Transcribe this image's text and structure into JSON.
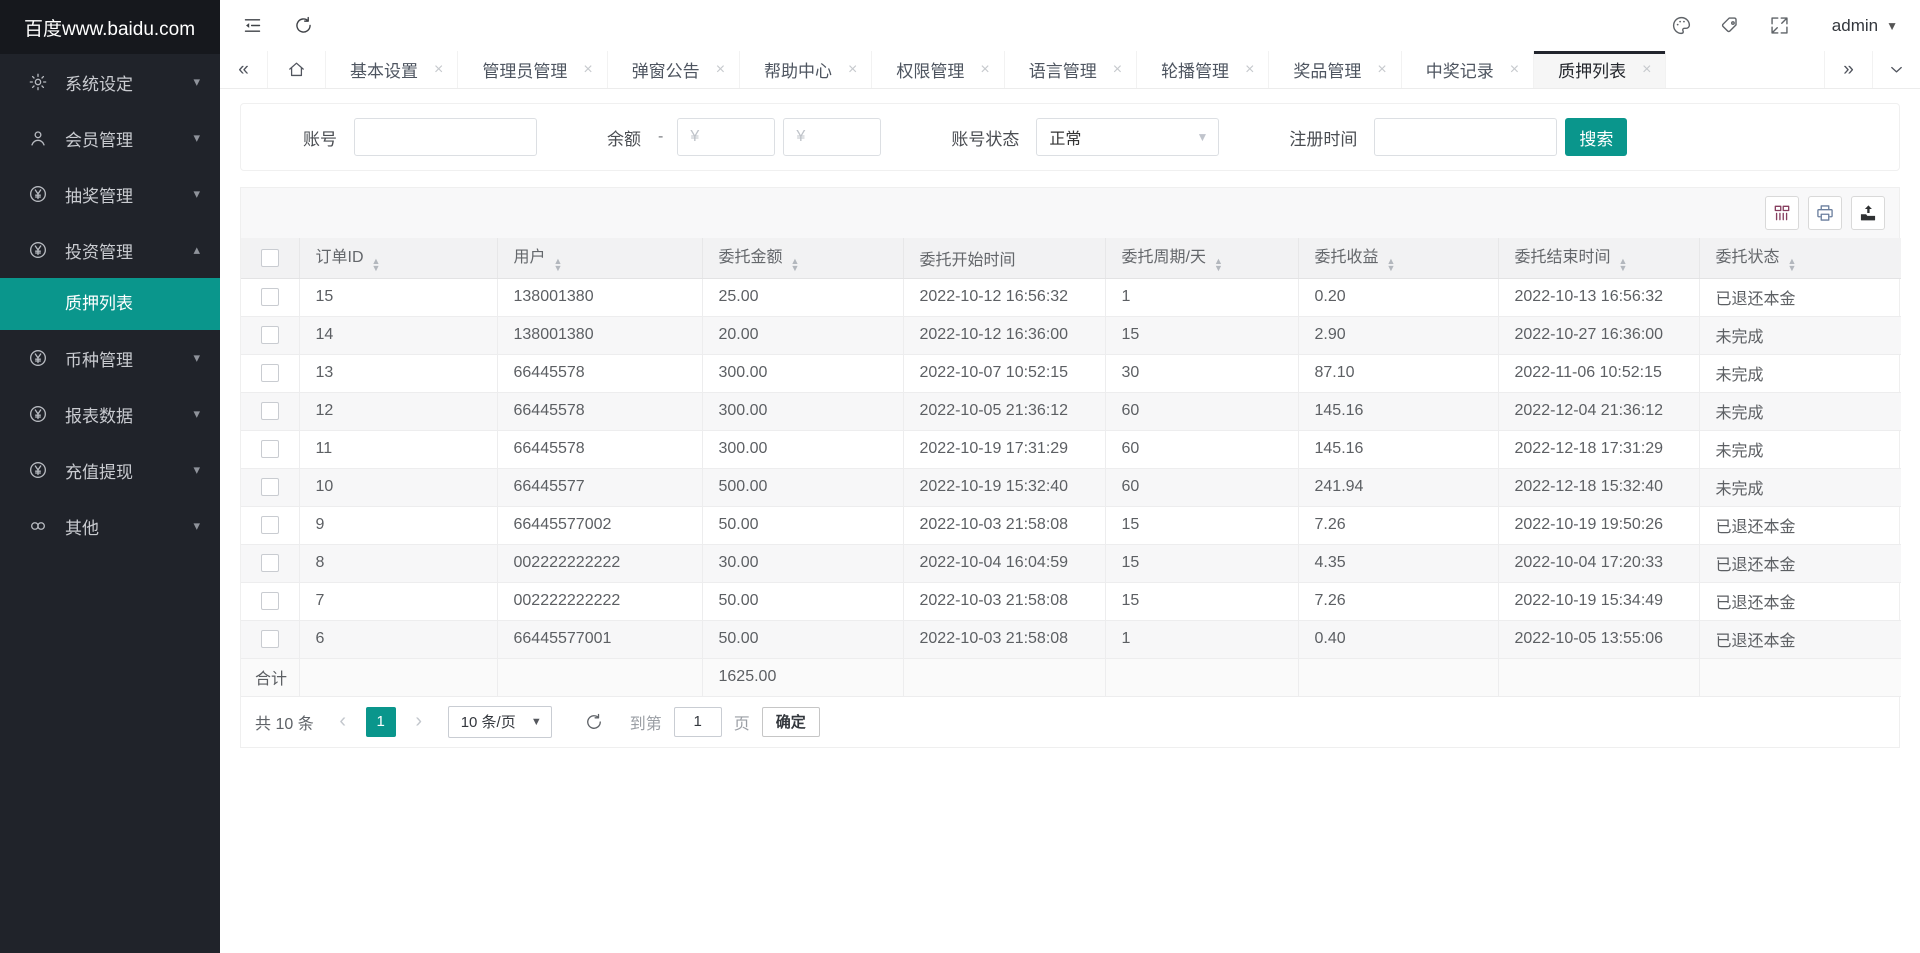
{
  "app": {
    "logo": "百度www.baidu.com",
    "admin_label": "admin"
  },
  "colors": {
    "accent_teal": "#0a968c",
    "sidebar_bg": "#20232a",
    "logo_bg": "#16181d",
    "active_tab_border": "#22252d"
  },
  "sidebar": {
    "items": [
      {
        "icon": "gear-icon",
        "label": "系统设定",
        "expanded": false
      },
      {
        "icon": "user-icon",
        "label": "会员管理",
        "expanded": false
      },
      {
        "icon": "yen-circle-icon",
        "label": "抽奖管理",
        "expanded": false
      },
      {
        "icon": "yen-circle-icon",
        "label": "投资管理",
        "expanded": true,
        "submenu": [
          {
            "label": "质押列表",
            "active": true
          }
        ]
      },
      {
        "icon": "yen-circle-icon",
        "label": "币种管理",
        "expanded": false
      },
      {
        "icon": "yen-circle-icon",
        "label": "报表数据",
        "expanded": false
      },
      {
        "icon": "yen-circle-icon",
        "label": "充值提现",
        "expanded": false
      },
      {
        "icon": "link-icon",
        "label": "其他",
        "expanded": false
      }
    ]
  },
  "tabbar": {
    "tabs": [
      {
        "label": "基本设置",
        "active": false
      },
      {
        "label": "管理员管理",
        "active": false
      },
      {
        "label": "弹窗公告",
        "active": false
      },
      {
        "label": "帮助中心",
        "active": false
      },
      {
        "label": "权限管理",
        "active": false
      },
      {
        "label": "语言管理",
        "active": false
      },
      {
        "label": "轮播管理",
        "active": false
      },
      {
        "label": "奖品管理",
        "active": false
      },
      {
        "label": "中奖记录",
        "active": false
      },
      {
        "label": "质押列表",
        "active": true
      }
    ]
  },
  "filter": {
    "account_label": "账号",
    "balance_label": "余额",
    "dash": "-",
    "amount_placeholder": "¥",
    "status_label": "账号状态",
    "status_value": "正常",
    "regtime_label": "注册时间",
    "search_label": "搜索"
  },
  "toolbar": {
    "buttons": [
      "columns-icon",
      "print-icon",
      "export-icon"
    ]
  },
  "table": {
    "columns": [
      {
        "label": "订单ID",
        "sortable": true
      },
      {
        "label": "用户",
        "sortable": true
      },
      {
        "label": "委托金额",
        "sortable": true
      },
      {
        "label": "委托开始时间",
        "sortable": false
      },
      {
        "label": "委托周期/天",
        "sortable": true
      },
      {
        "label": "委托收益",
        "sortable": true
      },
      {
        "label": "委托结束时间",
        "sortable": true
      },
      {
        "label": "委托状态",
        "sortable": true
      }
    ],
    "rows": [
      [
        "15",
        "138001380",
        "25.00",
        "2022-10-12 16:56:32",
        "1",
        "0.20",
        "2022-10-13 16:56:32",
        "已退还本金"
      ],
      [
        "14",
        "138001380",
        "20.00",
        "2022-10-12 16:36:00",
        "15",
        "2.90",
        "2022-10-27 16:36:00",
        "未完成"
      ],
      [
        "13",
        "66445578",
        "300.00",
        "2022-10-07 10:52:15",
        "30",
        "87.10",
        "2022-11-06 10:52:15",
        "未完成"
      ],
      [
        "12",
        "66445578",
        "300.00",
        "2022-10-05 21:36:12",
        "60",
        "145.16",
        "2022-12-04 21:36:12",
        "未完成"
      ],
      [
        "11",
        "66445578",
        "300.00",
        "2022-10-19 17:31:29",
        "60",
        "145.16",
        "2022-12-18 17:31:29",
        "未完成"
      ],
      [
        "10",
        "66445577",
        "500.00",
        "2022-10-19 15:32:40",
        "60",
        "241.94",
        "2022-12-18 15:32:40",
        "未完成"
      ],
      [
        "9",
        "66445577002",
        "50.00",
        "2022-10-03 21:58:08",
        "15",
        "7.26",
        "2022-10-19 19:50:26",
        "已退还本金"
      ],
      [
        "8",
        "002222222222",
        "30.00",
        "2022-10-04 16:04:59",
        "15",
        "4.35",
        "2022-10-04 17:20:33",
        "已退还本金"
      ],
      [
        "7",
        "002222222222",
        "50.00",
        "2022-10-03 21:58:08",
        "15",
        "7.26",
        "2022-10-19 15:34:49",
        "已退还本金"
      ],
      [
        "6",
        "66445577001",
        "50.00",
        "2022-10-03 21:58:08",
        "1",
        "0.40",
        "2022-10-05 13:55:06",
        "已退还本金"
      ]
    ],
    "summary": {
      "label": "合计",
      "amount_total": "1625.00"
    }
  },
  "pagination": {
    "total": "共 10 条",
    "page": "1",
    "per_page": "10 条/页",
    "goto_prefix": "到第",
    "goto_value": "1",
    "goto_suffix": "页",
    "confirm": "确定"
  }
}
